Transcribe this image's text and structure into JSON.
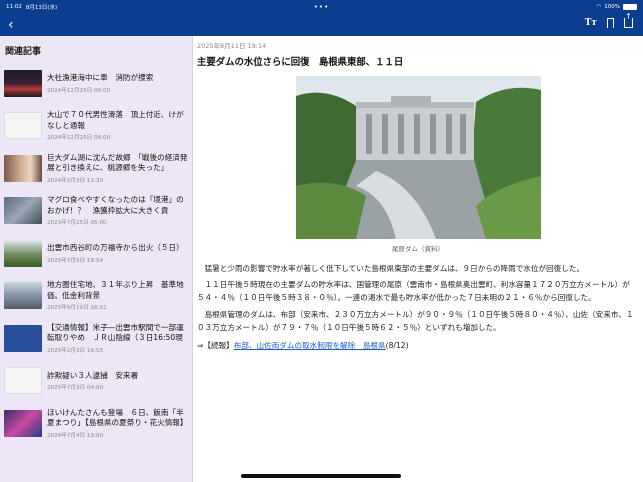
{
  "status_bar": {
    "time": "11:02",
    "date": "8月13日(水)",
    "battery": "100%"
  },
  "sidebar": {
    "title": "関連記事",
    "items": [
      {
        "title": "大社漁港海中に車　消防が捜索",
        "date": "2024年12月25日 06:00"
      },
      {
        "title": "大山で７０代男性滑落　頂上付近、けがなしと通報",
        "date": "2024年12月25日 06:00"
      },
      {
        "title": "巨大ダム湖に沈んだ故郷　「戦後の経済発展と引き換えに、桃源郷を失った」",
        "date": "2024年2月3日 11:30"
      },
      {
        "title": "マグロ食べやすくなったのは「境港」のおかげ！？　漁獲枠拡大に大きく貢献、…",
        "date": "2023年7月25日 05:00"
      },
      {
        "title": "出雲市西谷町の万福寺から出火（５日）",
        "date": "2025年7月5日 18:54"
      },
      {
        "title": "地方圏住宅地、３１年ぶり上昇　基準地価、低金利背景",
        "date": "2023年9月19日 16:52"
      },
      {
        "title": "【交通情報】米子―出雲市駅間で一部運転取りやめ　ＪＲ山陰線（３日16:50現在）",
        "date": "2025年2月3日 16:55"
      },
      {
        "title": "詐欺疑い３人逮捕　安来署",
        "date": "2025年7月3日 04:00"
      },
      {
        "title": "ほいけんたさんも登場　６日、飯南「半夏まつり」【島根県の夏祭り・花火情報】",
        "date": "2024年7月4日 19:00"
      }
    ]
  },
  "article": {
    "date": "2025年8月11日 19:14",
    "title": "主要ダムの水位さらに回復　島根県東部、１１日",
    "caption": "尾原ダム（資料）",
    "paragraphs": [
      "猛暑と少雨の影響で貯水率が著しく低下していた島根県東部の主要ダムは、９日からの降雨で水位が回復した。",
      "１１日午後５時現在の主要ダムの貯水率は、国管理の尾原（雲南市・島根県奥出雲町、利水容量１７２０万立方メートル）が５４・４％（１０日午後５時３８・０％）。一連の渇水で最も貯水率が低かった７日未明の２１・６％から回復した。",
      "島根県管理のダムは、布部（安来市、２３０万立方メートル）が９０・９％（１０日午後５時８０・４％）、山佐（安来市、１０３万立方メートル）が７９・７％（１０日午後５時６２・５％）といずれも増加した。"
    ],
    "related": {
      "prefix": "⇒【続報】",
      "link": "布部、山佐両ダムの取水制限を解除　島根県",
      "date": "(8/12)"
    }
  },
  "colors": {
    "nav_bar": "#0b3d91",
    "sidebar_bg": "#ede6f6",
    "link": "#1a5cc8"
  },
  "icons": [
    "back-chevron-icon",
    "font-size-icon",
    "bookmark-icon",
    "share-icon",
    "wifi-icon",
    "battery-icon"
  ]
}
